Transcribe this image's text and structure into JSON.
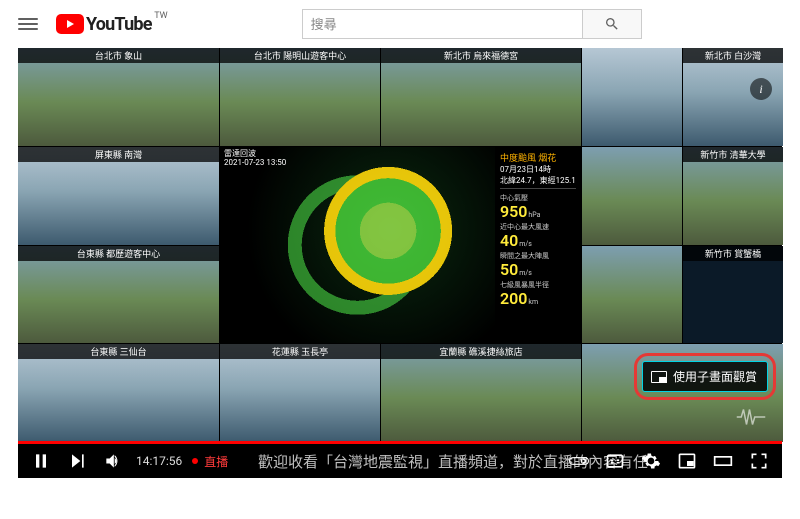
{
  "header": {
    "logo_text": "YouTube",
    "country_code": "TW",
    "search_placeholder": "搜尋"
  },
  "video": {
    "tiles": {
      "r1c1": "台北市 象山",
      "r1c2": "台北市 陽明山遊客中心",
      "r1c3": "新北市 烏來福德宮",
      "r1c4": "",
      "r1c5": "新北市 白沙灣",
      "r2c1": "屏東縣 南灣",
      "r2c4": "",
      "r2c5": "新竹市 清華大學",
      "r3c1": "台東縣 都歷遊客中心",
      "r3c4": "",
      "r3c5": "新竹市 賞蟹橋",
      "r4c1": "台東縣 三仙台",
      "r4c2": "花蓮縣 玉長亭",
      "r4c3": "宜蘭縣 礁溪捷絲旅店",
      "r4c4": ""
    },
    "radar": {
      "map_title_1": "雷達回波",
      "map_title_2": "2021-07-23 13:50",
      "side_head_1": "中度颱風 烟花",
      "side_head_2": "07月23日14時",
      "side_head_3": "北緯24.7，東經125.1",
      "stat1_lbl": "中心氣壓",
      "stat1_val": "950",
      "stat1_unit": "hPa",
      "stat2_lbl": "近中心最大風速",
      "stat2_val": "40",
      "stat2_unit": "m/s",
      "stat3_lbl": "瞬間之最大陣風",
      "stat3_val": "50",
      "stat3_unit": "m/s",
      "stat4_lbl": "七級風暴風半徑",
      "stat4_val": "200",
      "stat4_unit": "km"
    },
    "pip_label": "使用子畫面觀賞",
    "time": "14:17:56",
    "live_label": "直播",
    "marquee": "歡迎收看「台灣地震監視」直播頻道，對於直播的內容有任"
  }
}
